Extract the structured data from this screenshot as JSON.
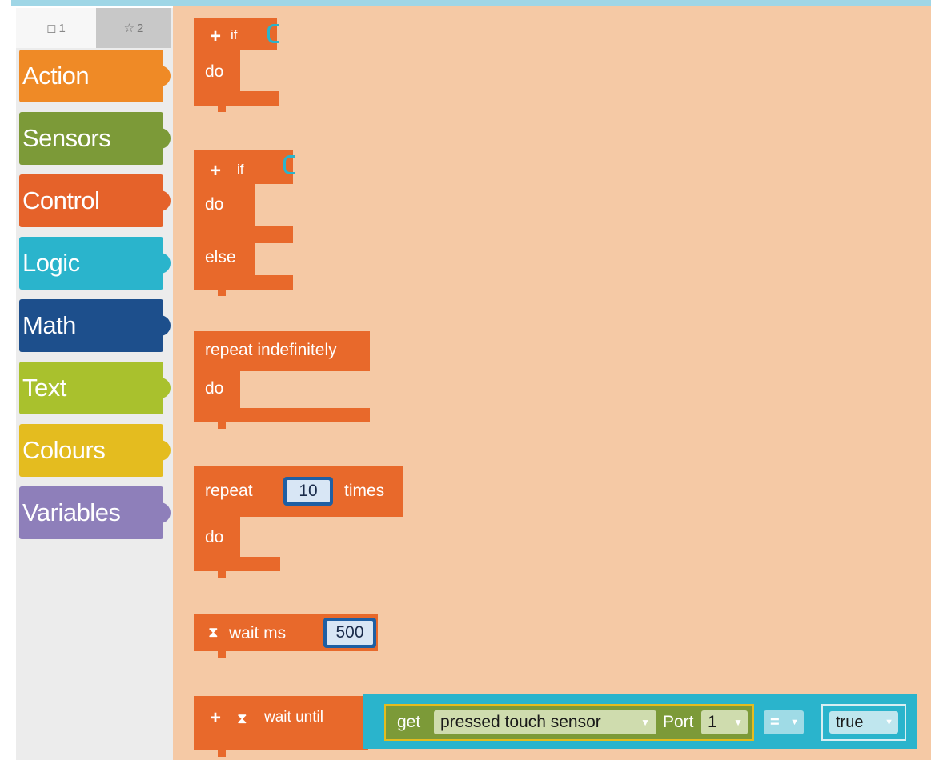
{
  "tabs": {
    "tab1_label": "1",
    "tab2_label": "2"
  },
  "categories": [
    {
      "label": "Action",
      "color": "#ef8a26"
    },
    {
      "label": "Sensors",
      "color": "#7c9a38"
    },
    {
      "label": "Control",
      "color": "#e5622a"
    },
    {
      "label": "Logic",
      "color": "#2ab4cc"
    },
    {
      "label": "Math",
      "color": "#1d4f8c"
    },
    {
      "label": "Text",
      "color": "#a9c12d"
    },
    {
      "label": "Colours",
      "color": "#e4bc1f"
    },
    {
      "label": "Variables",
      "color": "#8e7fba"
    }
  ],
  "blocks": {
    "if1": {
      "if": "if",
      "do": "do"
    },
    "if2": {
      "if": "if",
      "do": "do",
      "else": "else"
    },
    "repeat_forever": {
      "title": "repeat indefinitely",
      "do": "do"
    },
    "repeat_times": {
      "repeat": "repeat",
      "count": "10",
      "times": "times",
      "do": "do"
    },
    "wait_ms": {
      "label": "wait ms",
      "value": "500"
    },
    "wait_until": {
      "label": "wait until",
      "get": "get",
      "sensor": "pressed touch sensor",
      "port_label": "Port",
      "port": "1",
      "operator": "=",
      "value": "true"
    }
  },
  "colors": {
    "workspace": "#f5c9a5",
    "control_block": "#e8692b",
    "sensor_block": "#7c9a38",
    "logic_block": "#2ab4cc",
    "math_block": "#1f5fa3"
  }
}
